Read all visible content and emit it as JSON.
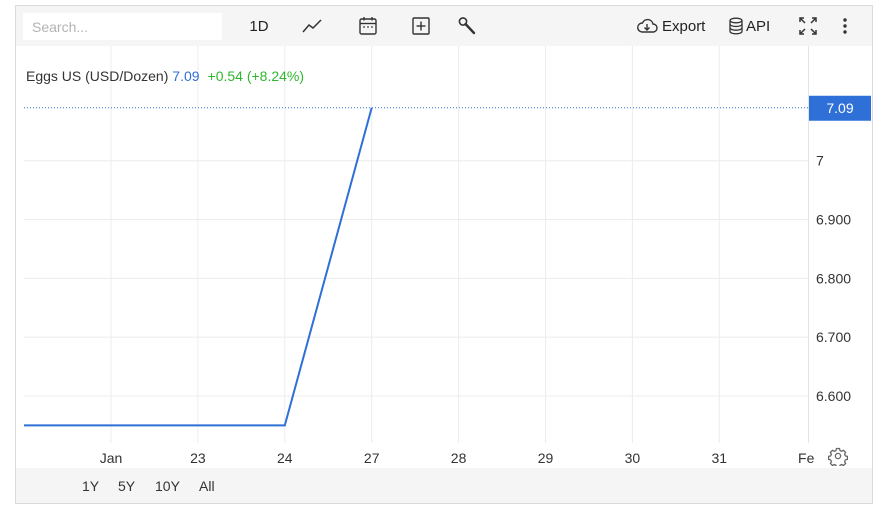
{
  "toolbar": {
    "search_placeholder": "Search...",
    "interval_label": "1D",
    "export_label": "Export",
    "api_label": "API",
    "icons": [
      "line-chart-icon",
      "calendar-icon",
      "add-box-icon",
      "wrench-icon",
      "cloud-download-icon",
      "database-icon",
      "fullscreen-icon",
      "more-vertical-icon"
    ]
  },
  "legend": {
    "name": "Eggs US (USD/Dozen)",
    "price": "7.09",
    "change": "+0.54 (+8.24%)",
    "price_color": "#2f6fd8",
    "change_color": "#2eb82e"
  },
  "chart_data": {
    "type": "line",
    "x_tick_labels": [
      "Jan",
      "23",
      "24",
      "27",
      "28",
      "29",
      "30",
      "31",
      "Fe"
    ],
    "y_tick_labels": [
      "7",
      "6.900",
      "6.800",
      "6.700",
      "6.600"
    ],
    "y_ticks": [
      7.0,
      6.9,
      6.8,
      6.7,
      6.6
    ],
    "ylim": [
      6.52,
      7.195
    ],
    "series": [
      {
        "x": [
          "22",
          "23",
          "24",
          "27"
        ],
        "values": [
          6.55,
          6.55,
          6.55,
          7.09
        ]
      }
    ],
    "last_price_label": "7.09",
    "line_color": "#2f6fd8",
    "grid": true
  },
  "bottom_bar": {
    "ranges": [
      "1Y",
      "5Y",
      "10Y",
      "All"
    ]
  }
}
